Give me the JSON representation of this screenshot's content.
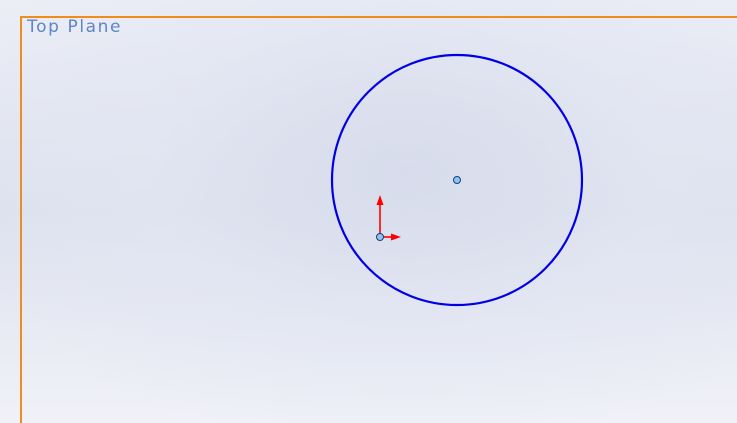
{
  "viewport": {
    "plane_label": "Top Plane"
  },
  "icons": {
    "origin": "origin-triad-icon",
    "center_point": "circle-center-point-icon"
  },
  "colors": {
    "plane_border": "#f08c1e",
    "plane_label": "#5f84c8",
    "sketch_circle": "#0000e6",
    "origin_y_axis": "#ff0000",
    "origin_x_axis": "#ff0000",
    "point_fill": "#8ec4f0",
    "point_stroke": "#1a3f7a"
  }
}
